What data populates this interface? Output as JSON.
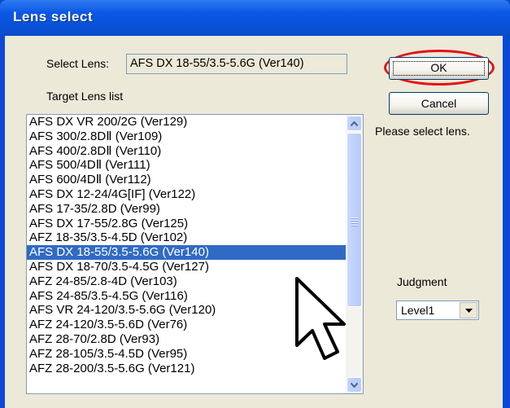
{
  "window": {
    "title": "Lens select"
  },
  "select_lens": {
    "label": "Select Lens:",
    "value": "AFS DX 18-55/3.5-5.6G (Ver140)"
  },
  "target_list": {
    "label": "Target Lens list",
    "selected_index": 9,
    "items": [
      "AFS DX VR 200/2G (Ver129)",
      "AFS 300/2.8DⅡ (Ver109)",
      "AFS 400/2.8DⅡ (Ver110)",
      "AFS 500/4DⅡ (Ver111)",
      "AFS 600/4DⅡ (Ver112)",
      "AFS DX 12-24/4G[IF] (Ver122)",
      "AFS 17-35/2.8D (Ver99)",
      "AFS DX 17-55/2.8G (Ver125)",
      "AFZ 18-35/3.5-4.5D (Ver102)",
      "AFS DX 18-55/3.5-5.6G (Ver140)",
      "AFS DX 18-70/3.5-4.5G (Ver127)",
      "AFZ 24-85/2.8-4D (Ver103)",
      "AFS 24-85/3.5-4.5G (Ver116)",
      "AFS VR 24-120/3.5-5.6G (Ver120)",
      "AFZ 24-120/3.5-5.6D (Ver76)",
      "AFZ 28-70/2.8D (Ver93)",
      "AFZ 28-105/3.5-4.5D (Ver95)",
      "AFZ 28-200/3.5-5.6G (Ver121)"
    ]
  },
  "buttons": {
    "ok": "OK",
    "cancel": "Cancel"
  },
  "hint": "Please select lens.",
  "judgment": {
    "label": "Judgment",
    "value": "Level1"
  },
  "colors": {
    "titlebar": "#0a48d8",
    "selection": "#316ac5",
    "highlight_oval": "#e0151b",
    "dialog_bg": "#ece9d8"
  },
  "icons": [
    "scroll-up-arrow-icon",
    "scroll-down-arrow-icon",
    "dropdown-arrow-icon",
    "mouse-pointer-icon"
  ]
}
